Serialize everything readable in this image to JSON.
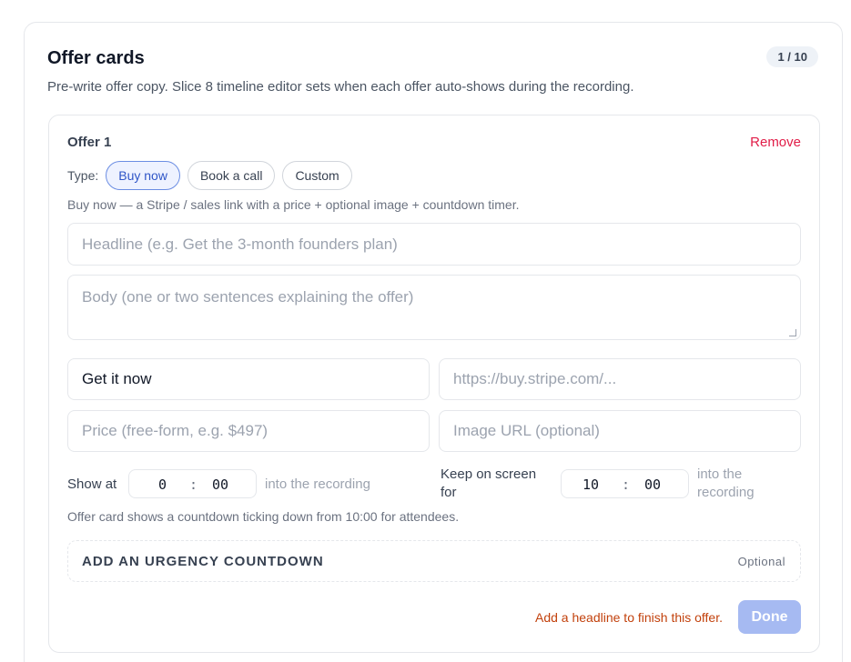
{
  "header": {
    "title": "Offer cards",
    "counter": "1 / 10",
    "subtitle": "Pre-write offer copy. Slice 8 timeline editor sets when each offer auto-shows during the recording."
  },
  "offer": {
    "title": "Offer 1",
    "remove_label": "Remove",
    "type_label": "Type:",
    "types": [
      "Buy now",
      "Book a call",
      "Custom"
    ],
    "selected_type": "Buy now",
    "type_description": "Buy now — a Stripe / sales link with a price + optional image + countdown timer.",
    "headline_placeholder": "Headline (e.g. Get the 3-month founders plan)",
    "body_placeholder": "Body (one or two sentences explaining the offer)",
    "cta_value": "Get it now",
    "link_placeholder": "https://buy.stripe.com/...",
    "price_placeholder": "Price (free-form, e.g. $497)",
    "image_placeholder": "Image URL (optional)",
    "show_at_label": "Show at",
    "show_at": {
      "minutes": "0",
      "seconds": "00"
    },
    "show_at_after": "into the recording",
    "keep_label_line1": "Keep on screen",
    "keep_label_line2": "for",
    "keep_for": {
      "minutes": "10",
      "seconds": "00"
    },
    "keep_after_line1": "into the",
    "keep_after_line2": "recording",
    "time_separator": ":",
    "countdown_note": "Offer card shows a countdown ticking down from 10:00 for attendees.",
    "urgency_title": "ADD AN URGENCY COUNTDOWN",
    "urgency_optional": "Optional",
    "hint": "Add a headline to finish this offer.",
    "done_label": "Done"
  },
  "colors": {
    "remove": "#e11d48",
    "active_pill": "#2f55c7",
    "hint": "#c2410c",
    "done_button": "#a6baf2"
  }
}
